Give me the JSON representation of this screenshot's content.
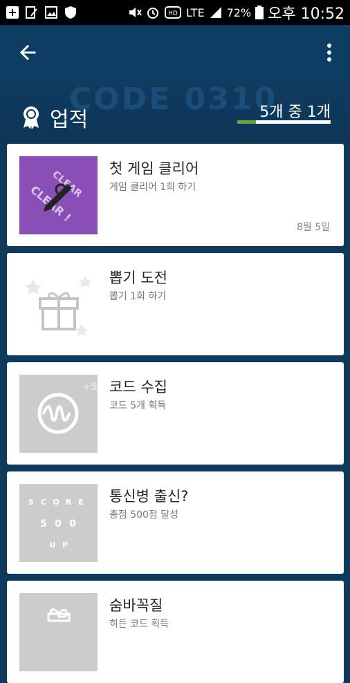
{
  "status_bar": {
    "battery_percent": "72%",
    "time": "오후 10:52",
    "network": "LTE"
  },
  "app_bar": {
    "back_icon": "arrow-back-icon",
    "more_icon": "more-vert-icon"
  },
  "header": {
    "title": "업적",
    "progress_text": "5개 중 1개",
    "progress_fraction": 0.2,
    "watermark": "CODE 0310"
  },
  "achievements": [
    {
      "title": "첫 게임 클리어",
      "desc": "게임 클리어 1회 하기",
      "date": "8월 5일",
      "icon": "clear-badge-icon",
      "unlocked": true
    },
    {
      "title": "뽑기 도전",
      "desc": "뽑기 1회 하기",
      "date": "",
      "icon": "gift-icon",
      "unlocked": false
    },
    {
      "title": "코드 수집",
      "desc": "코드 5개 획득",
      "date": "",
      "icon": "wave-code-icon",
      "unlocked": false
    },
    {
      "title": "통신병 출신?",
      "desc": "총점 500점 달성",
      "date": "",
      "icon": "score-500-up-icon",
      "unlocked": false
    },
    {
      "title": "숨바꼭질",
      "desc": "히든 코드 획득",
      "date": "",
      "icon": "hidden-gift-icon",
      "unlocked": false
    }
  ],
  "colors": {
    "accent": "#6aa53b",
    "unlocked_bg": "#8a4fb6",
    "locked_bg": "#cccccc"
  }
}
